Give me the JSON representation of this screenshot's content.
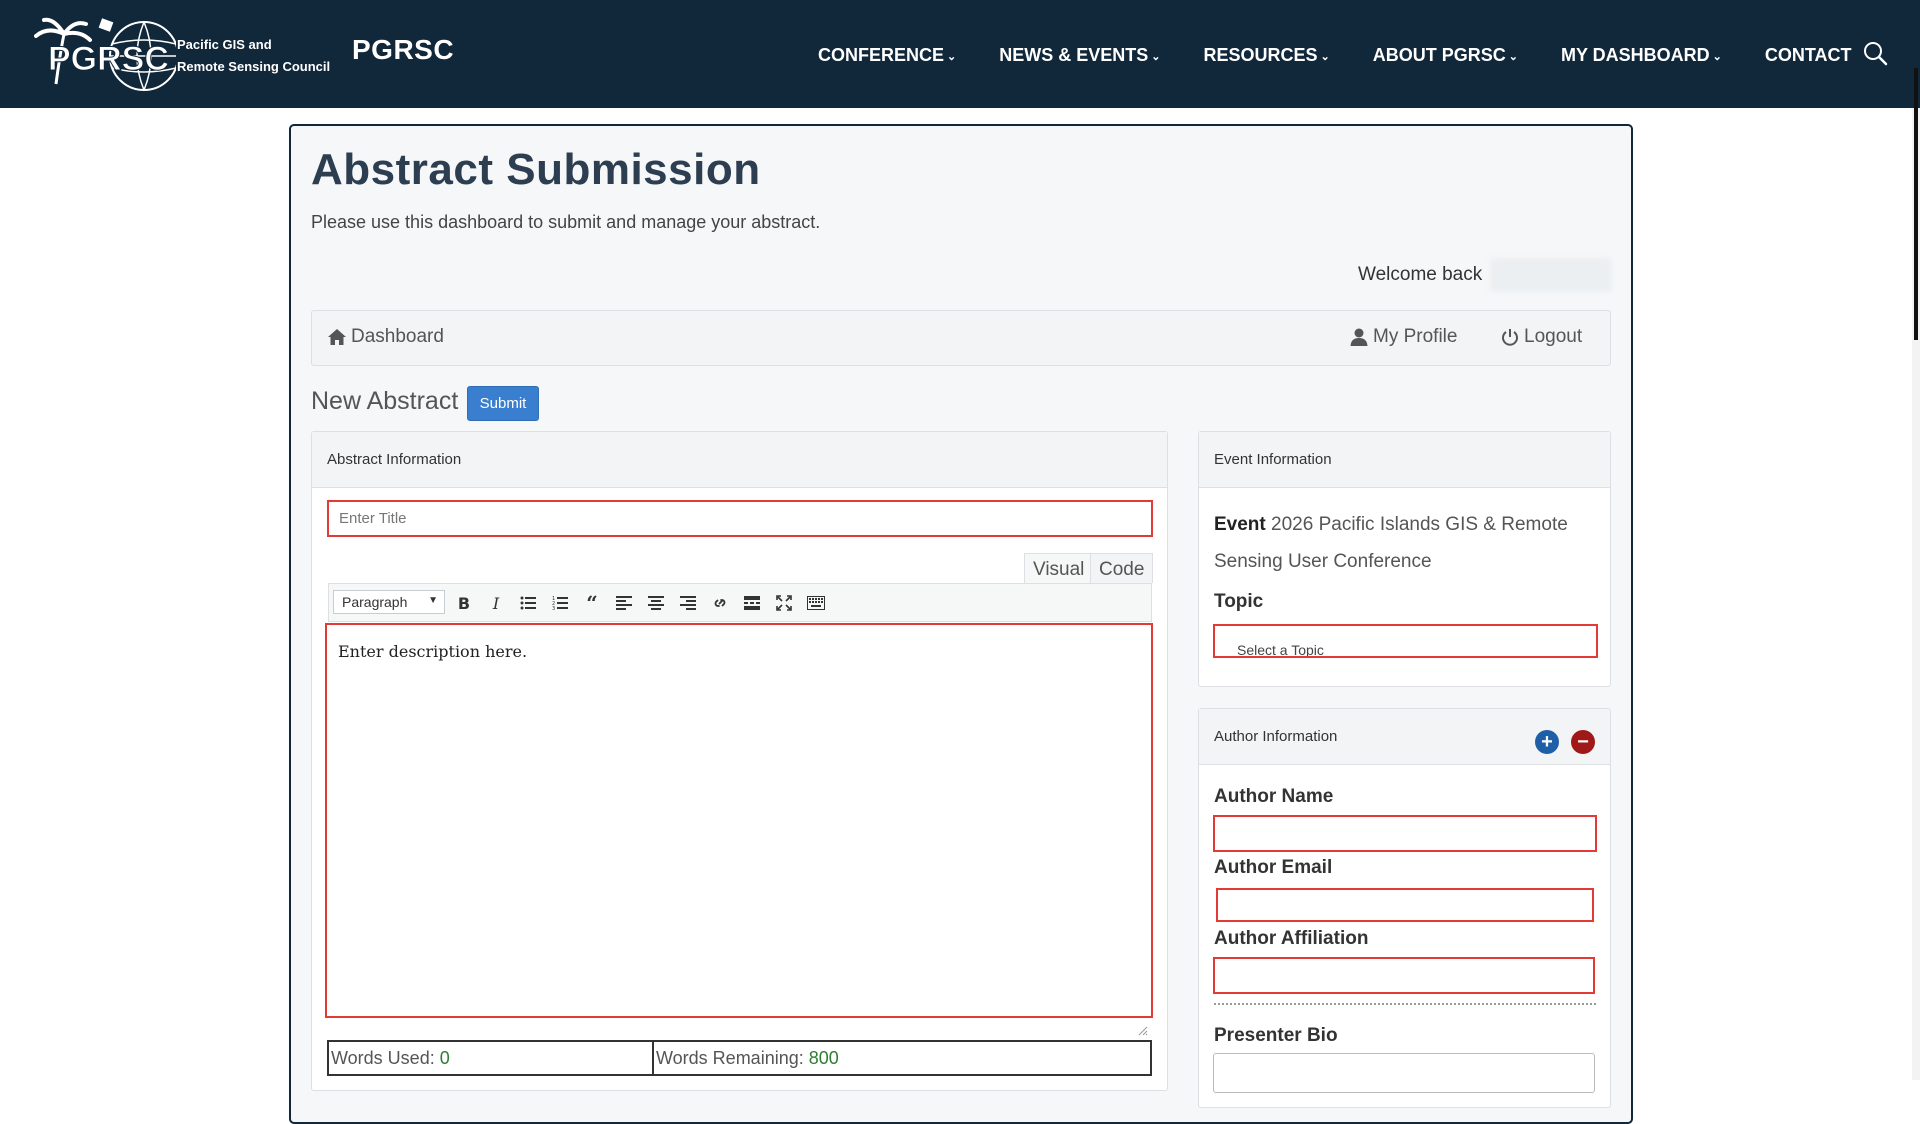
{
  "header": {
    "logo_text": "PGRSC",
    "org_name_line1": "Pacific GIS and",
    "org_name_line2": "Remote Sensing Council",
    "brand": "PGRSC",
    "nav": [
      {
        "label": "CONFERENCE",
        "dropdown": true
      },
      {
        "label": "NEWS & EVENTS",
        "dropdown": true
      },
      {
        "label": "RESOURCES",
        "dropdown": true
      },
      {
        "label": "ABOUT PGRSC",
        "dropdown": true
      },
      {
        "label": "MY DASHBOARD",
        "dropdown": true
      },
      {
        "label": "CONTACT",
        "dropdown": false
      }
    ],
    "search_icon": "search-icon"
  },
  "page": {
    "title": "Abstract Submission",
    "subtitle": "Please use this dashboard to submit and manage your abstract.",
    "welcome": "Welcome back"
  },
  "subnav": {
    "dashboard": "Dashboard",
    "profile": "My Profile",
    "logout": "Logout"
  },
  "form": {
    "heading": "New Abstract",
    "submit_label": "Submit",
    "abstract_panel": {
      "title": "Abstract Information",
      "title_placeholder": "Enter Title",
      "tab_visual": "Visual",
      "tab_code": "Code",
      "format_select": "Paragraph",
      "editor_placeholder": "Enter description here.",
      "words_used_label": "Words Used:",
      "words_used": "0",
      "words_remaining_label": "Words Remaining:",
      "words_remaining": "800"
    },
    "event_panel": {
      "title": "Event Information",
      "event_label": "Event",
      "event_name_line1": "2026 Pacific Islands GIS & Remote",
      "event_name_line2": "Sensing User Conference",
      "topic_label": "Topic",
      "topic_placeholder": "Select a Topic"
    },
    "author_panel": {
      "title": "Author Information",
      "add_label": "+",
      "remove_label": "−",
      "author_name_label": "Author Name",
      "author_email_label": "Author Email",
      "author_affiliation_label": "Author Affiliation",
      "presenter_bio_label": "Presenter Bio"
    }
  },
  "colors": {
    "header_bg": "#11273a",
    "required_border": "#e53935",
    "submit_bg": "#3a7fcf",
    "add_btn": "#1f5fa8",
    "remove_btn": "#a01818",
    "counter_number": "#2e7d32"
  }
}
